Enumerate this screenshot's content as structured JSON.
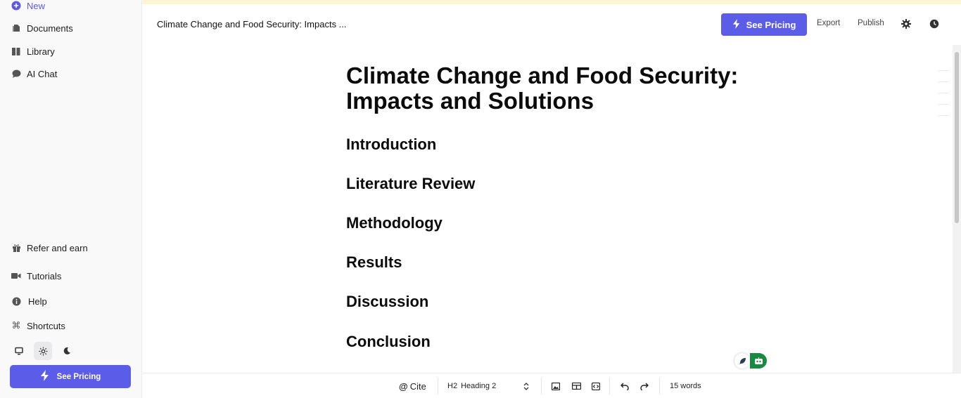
{
  "sidebar": {
    "new_label": "New",
    "items": [
      {
        "label": "Documents",
        "icon": "documents-icon"
      },
      {
        "label": "Library",
        "icon": "library-icon"
      },
      {
        "label": "AI Chat",
        "icon": "chat-icon"
      }
    ],
    "bottom_items": [
      {
        "label": "Refer and earn",
        "icon": "gift-icon"
      },
      {
        "label": "Tutorials",
        "icon": "video-icon"
      },
      {
        "label": "Help",
        "icon": "info-icon"
      },
      {
        "label": "Shortcuts",
        "icon": "command-icon"
      }
    ],
    "pricing_label": "See Pricing"
  },
  "header": {
    "doc_title": "Climate Change and Food Security: Impacts ...",
    "pricing_label": "See Pricing",
    "export_label": "Export",
    "publish_label": "Publish"
  },
  "document": {
    "title": "Climate Change and Food Security: Impacts and Solutions",
    "headings": [
      "Introduction",
      "Literature Review",
      "Methodology",
      "Results",
      "Discussion",
      "Conclusion"
    ]
  },
  "toolbar": {
    "cite_label": "Cite",
    "style_code": "H2",
    "style_label": "Heading 2",
    "word_count": "15 words"
  },
  "colors": {
    "accent": "#5b5ce8",
    "banner": "#fdf6d5",
    "float_green": "#1a8a42"
  }
}
